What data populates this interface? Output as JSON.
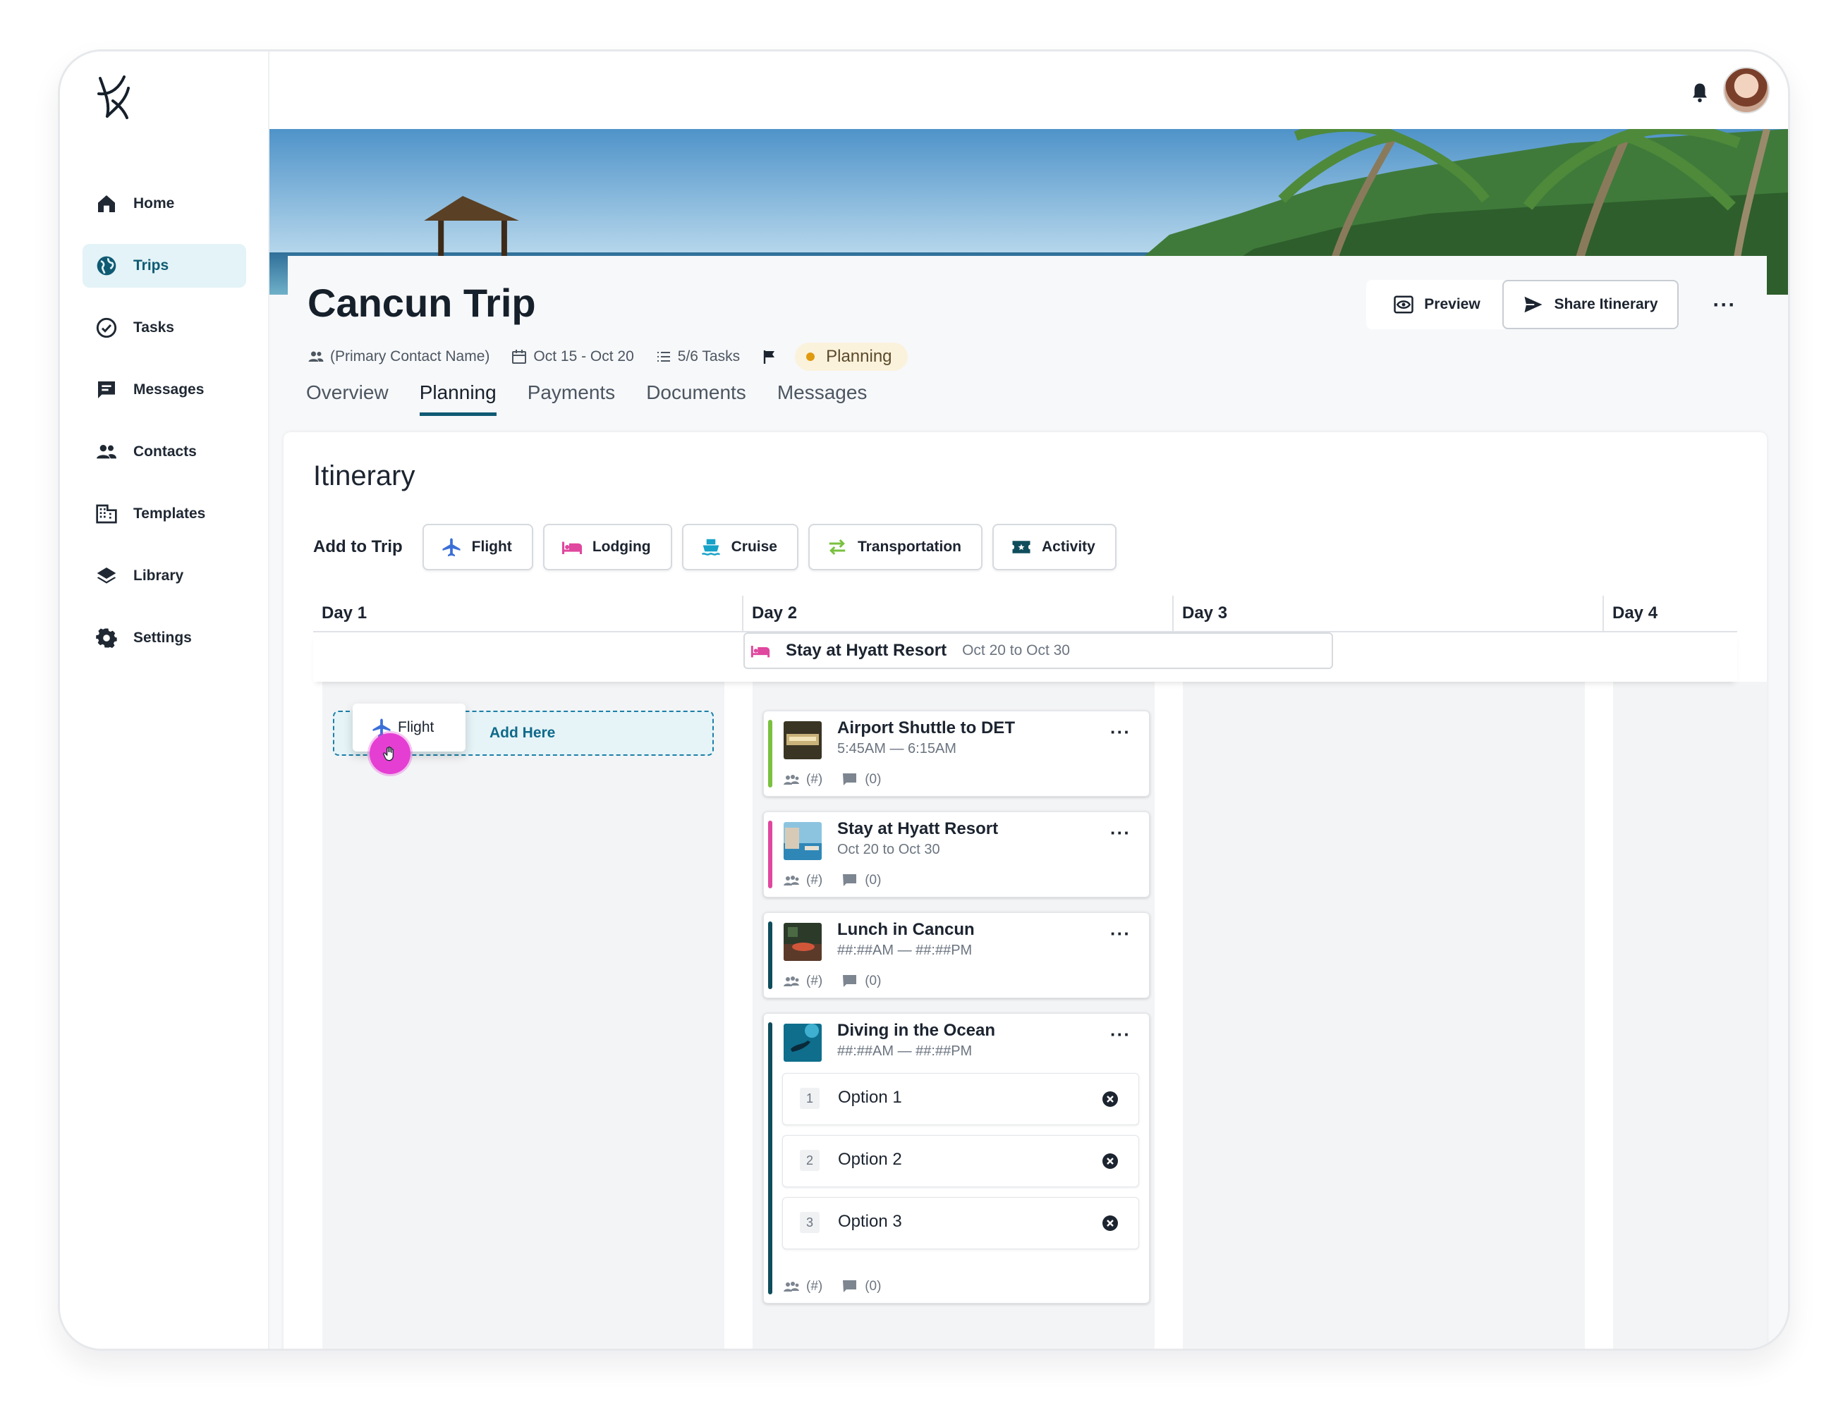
{
  "sidebar": {
    "items": [
      {
        "label": "Home",
        "icon": "home-icon"
      },
      {
        "label": "Trips",
        "icon": "globe-icon",
        "active": true
      },
      {
        "label": "Tasks",
        "icon": "check-circle-icon"
      },
      {
        "label": "Messages",
        "icon": "message-icon"
      },
      {
        "label": "Contacts",
        "icon": "people-icon"
      },
      {
        "label": "Templates",
        "icon": "building-icon"
      },
      {
        "label": "Library",
        "icon": "layers-icon"
      },
      {
        "label": "Settings",
        "icon": "gear-icon"
      }
    ]
  },
  "header": {
    "title": "Cancun Trip",
    "contact": "(Primary Contact Name)",
    "dates": "Oct 15 - Oct 20",
    "tasks": "5/6 Tasks",
    "status": "Planning",
    "preview_label": "Preview",
    "share_label": "Share Itinerary",
    "more_label": "···"
  },
  "tabs": [
    "Overview",
    "Planning",
    "Payments",
    "Documents",
    "Messages"
  ],
  "active_tab": "Planning",
  "itinerary": {
    "title": "Itinerary",
    "add_label": "Add to Trip",
    "add_buttons": [
      {
        "label": "Flight",
        "icon": "plane-icon",
        "color": "#3b6fd8"
      },
      {
        "label": "Lodging",
        "icon": "bed-icon",
        "color": "#e0479e"
      },
      {
        "label": "Cruise",
        "icon": "ship-icon",
        "color": "#17a2c8"
      },
      {
        "label": "Transportation",
        "icon": "arrows-icon",
        "color": "#7ac13f"
      },
      {
        "label": "Activity",
        "icon": "ticket-icon",
        "color": "#0f4d5c"
      }
    ],
    "days": [
      "Day 1",
      "Day 2",
      "Day 3",
      "Day 4"
    ],
    "span": {
      "title": "Stay at Hyatt Resort",
      "dates": "Oct 20 to Oct 30"
    },
    "drag": {
      "chip_label": "Flight",
      "drop_label": "Add Here"
    },
    "cards": [
      {
        "title": "Airport Shuttle to DET",
        "sub": "5:45AM — 6:15AM",
        "people": "(#)",
        "comments": "(0)",
        "stripe": "#7ac13f"
      },
      {
        "title": "Stay at Hyatt Resort",
        "sub": "Oct 20 to Oct 30",
        "people": "(#)",
        "comments": "(0)",
        "stripe": "#e0479e"
      },
      {
        "title": "Lunch in Cancun",
        "sub": "##:##AM — ##:##PM",
        "people": "(#)",
        "comments": "(0)",
        "stripe": "#0f4d5c"
      },
      {
        "title": "Diving in the Ocean",
        "sub": "##:##AM — ##:##PM",
        "people": "(#)",
        "comments": "(0)",
        "stripe": "#0f4d5c",
        "options": [
          {
            "num": "1",
            "label": "Option 1"
          },
          {
            "num": "2",
            "label": "Option 2"
          },
          {
            "num": "3",
            "label": "Option 3"
          }
        ]
      }
    ],
    "card_more": "···"
  }
}
